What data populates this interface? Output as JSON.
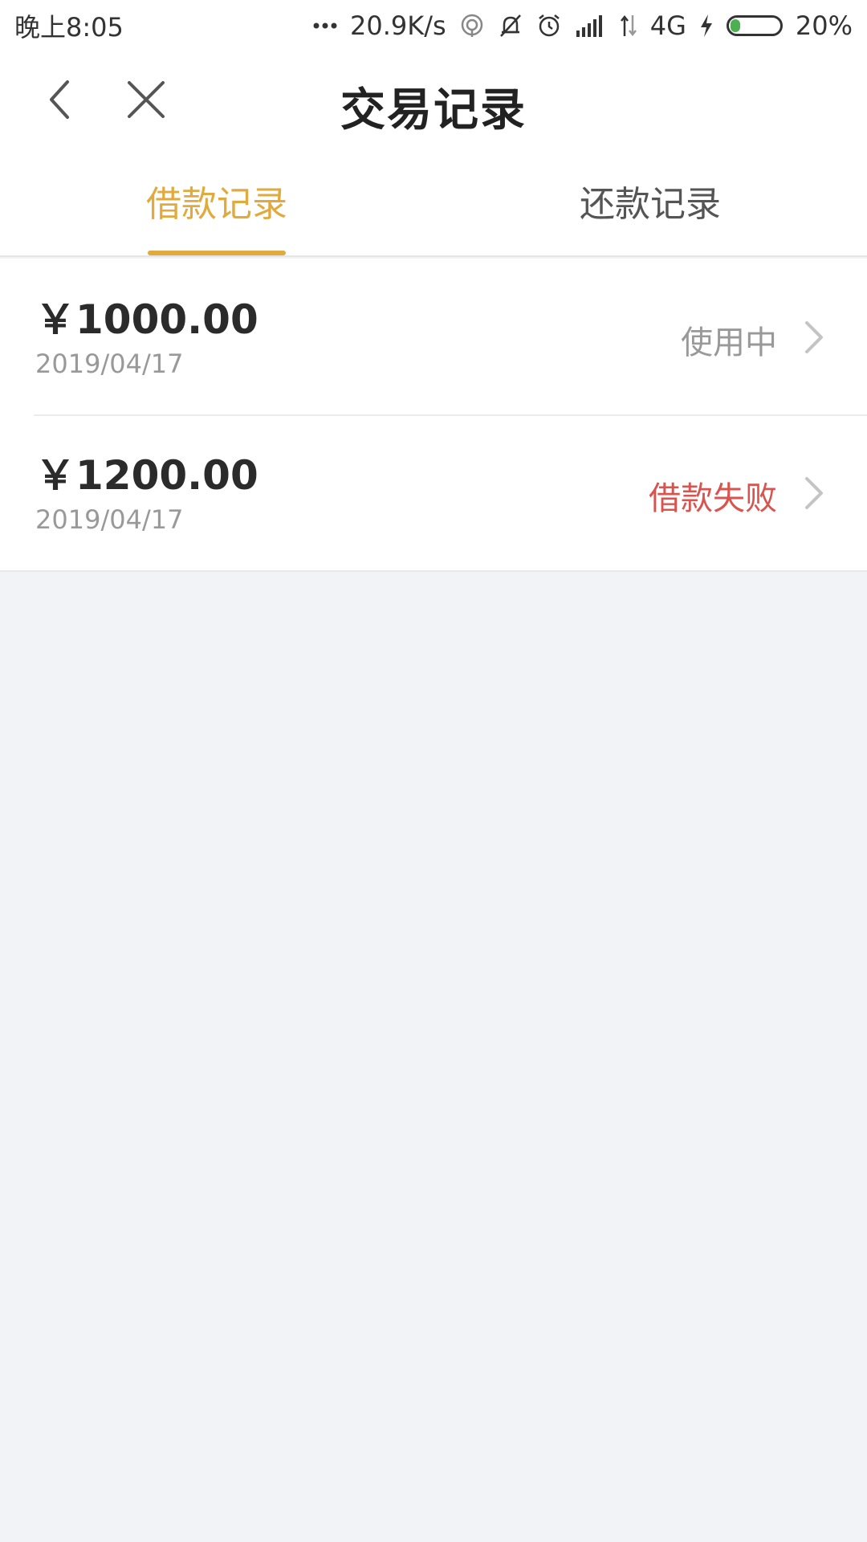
{
  "status_bar": {
    "time": "晚上8:05",
    "network_speed": "20.9K/s",
    "network_type": "4G",
    "battery_percent": "20%",
    "battery_level": 0.2,
    "icons": [
      "more-dots-icon",
      "hotspot-icon",
      "mute-bell-icon",
      "alarm-icon",
      "signal-icon",
      "data-arrows-icon",
      "charging-icon",
      "battery-icon"
    ]
  },
  "header": {
    "title": "交易记录",
    "back_icon": "chevron-left-icon",
    "close_icon": "close-icon"
  },
  "tabs": [
    {
      "label": "借款记录",
      "active": true
    },
    {
      "label": "还款记录",
      "active": false
    }
  ],
  "records": [
    {
      "amount": "￥1000.00",
      "date": "2019/04/17",
      "status": "使用中",
      "status_color": "#999999"
    },
    {
      "amount": "￥1200.00",
      "date": "2019/04/17",
      "status": "借款失败",
      "status_color": "#d9534f"
    }
  ],
  "colors": {
    "accent": "#e1aa3f",
    "background": "#f2f3f7",
    "error": "#d9534f"
  }
}
